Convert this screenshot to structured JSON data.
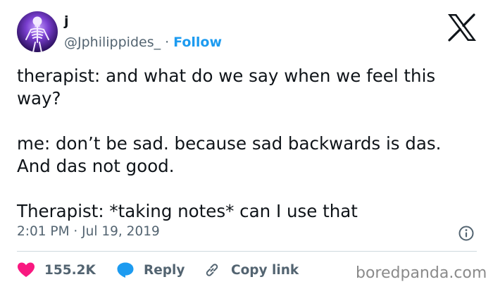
{
  "author": {
    "name": "j",
    "handle": "@Jphilippides_",
    "separator": "·",
    "follow_label": "Follow"
  },
  "tweet": {
    "paragraphs": [
      "therapist: and what do we say when we feel this way?",
      "me: don’t be sad. because sad backwards is das. And das not good.",
      "Therapist: *taking notes* can I use that"
    ],
    "timestamp": "2:01 PM · Jul 19, 2019"
  },
  "actions": {
    "likes": "155.2K",
    "reply_label": "Reply",
    "copy_link_label": "Copy link"
  },
  "icons": {
    "like": "heart-icon",
    "reply": "speech-bubble-icon",
    "copy_link": "link-icon",
    "info": "info-icon",
    "platform": "x-logo-icon"
  },
  "colors": {
    "like": "#f91880",
    "reply": "#1d9bf0",
    "follow": "#1d9bf0",
    "muted": "#536471"
  },
  "watermark": "boredpanda.com"
}
